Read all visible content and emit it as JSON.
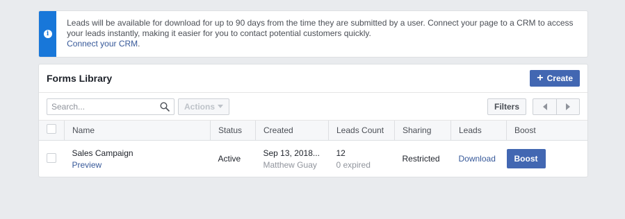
{
  "notice": {
    "icon": "info-icon",
    "message": "Leads will be available for download for up to 90 days from the time they are submitted by a user. Connect your page to a CRM to access your leads instantly, making it easier for you to contact potential customers quickly.",
    "link_text": "Connect your CRM",
    "link_suffix": "."
  },
  "forms_library": {
    "title": "Forms Library",
    "create_button": "Create",
    "search_placeholder": "Search...",
    "actions_label": "Actions",
    "filters_label": "Filters",
    "columns": [
      "Name",
      "Status",
      "Created",
      "Leads Count",
      "Sharing",
      "Leads",
      "Boost"
    ],
    "rows": [
      {
        "name": "Sales Campaign",
        "preview": "Preview",
        "status": "Active",
        "created_date": "Sep 13, 2018...",
        "created_by": "Matthew Guay",
        "leads_count": "12",
        "expired": "0 expired",
        "sharing": "Restricted",
        "leads": "Download",
        "boost": "Boost"
      }
    ]
  },
  "colors": {
    "accent": "#4267b2",
    "notice_bar": "#1877d9",
    "link": "#365899",
    "background": "#e9ebee"
  }
}
